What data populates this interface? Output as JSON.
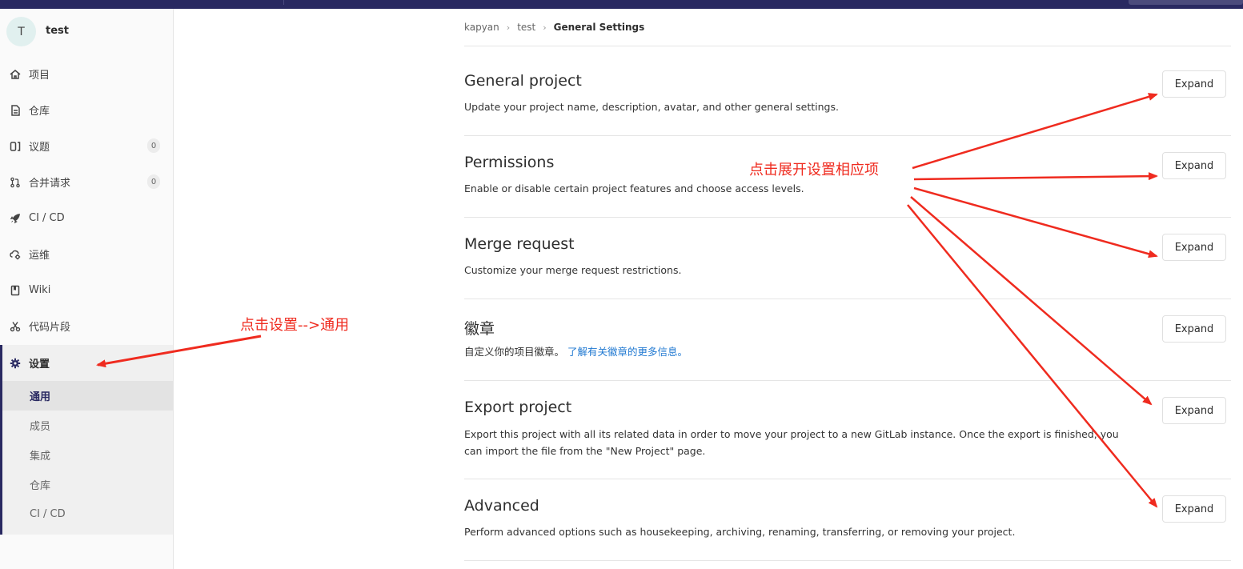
{
  "sidebar": {
    "project_avatar": "T",
    "project_name": "test",
    "items": [
      {
        "label": "项目",
        "count": null
      },
      {
        "label": "仓库",
        "count": null
      },
      {
        "label": "议题",
        "count": "0"
      },
      {
        "label": "合并请求",
        "count": "0"
      },
      {
        "label": "CI / CD",
        "count": null
      },
      {
        "label": "运维",
        "count": null
      },
      {
        "label": "Wiki",
        "count": null
      },
      {
        "label": "代码片段",
        "count": null
      },
      {
        "label": "设置",
        "count": null
      }
    ],
    "settings_subitems": [
      "通用",
      "成员",
      "集成",
      "仓库",
      "CI / CD"
    ]
  },
  "breadcrumb": {
    "items": [
      "kapyan",
      "test",
      "General Settings"
    ]
  },
  "sections": [
    {
      "title": "General project",
      "description": "Update your project name, description, avatar, and other general settings.",
      "button": "Expand"
    },
    {
      "title": "Permissions",
      "description": "Enable or disable certain project features and choose access levels.",
      "button": "Expand"
    },
    {
      "title": "Merge request",
      "description": "Customize your merge request restrictions.",
      "button": "Expand"
    },
    {
      "title": "徽章",
      "description": "自定义你的项目徽章。",
      "link": "了解有关徽章的更多信息。",
      "button": "Expand"
    },
    {
      "title": "Export project",
      "description": "Export this project with all its related data in order to move your project to a new GitLab instance. Once the export is finished, you can import the file from the \"New Project\" page.",
      "button": "Expand"
    },
    {
      "title": "Advanced",
      "description": "Perform advanced options such as housekeeping, archiving, renaming, transferring, or removing your project.",
      "button": "Expand"
    }
  ],
  "annotations": {
    "settings_note": "点击设置-->通用",
    "expand_note": "点击展开设置相应项"
  },
  "colors": {
    "annotation": "#ef2b1f",
    "topbar": "#292961",
    "link": "#1f78d1"
  }
}
